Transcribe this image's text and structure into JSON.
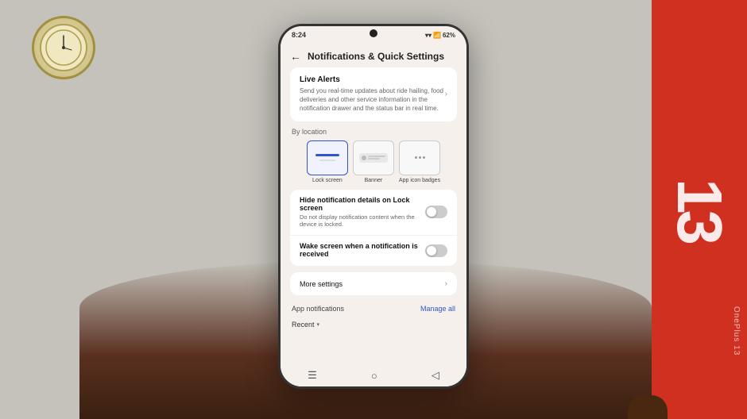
{
  "scene": {
    "bg_color": "#c5c2bb"
  },
  "status_bar": {
    "time": "8:24",
    "battery": "62%",
    "wifi": "WiFi"
  },
  "header": {
    "back_label": "←",
    "title": "Notifications & Quick Settings"
  },
  "live_alerts": {
    "title": "Live Alerts",
    "description": "Send you real-time updates about ride hailing, food deliveries and other service information in the notification drawer and the status bar in real time."
  },
  "by_location": {
    "label": "By location",
    "types": [
      {
        "id": "lock_screen",
        "label": "Lock screen",
        "active": true,
        "type": "bar"
      },
      {
        "id": "banner",
        "label": "Banner",
        "active": false,
        "type": "banner"
      },
      {
        "id": "app_icon_badges",
        "label": "App icon badges",
        "active": false,
        "type": "dots"
      }
    ]
  },
  "toggles": [
    {
      "id": "hide_notification",
      "title": "Hide notification details on Lock screen",
      "desc": "Do not display notification content when the device is locked.",
      "on": false
    },
    {
      "id": "wake_screen",
      "title": "Wake screen when a notification is received",
      "desc": "",
      "on": false
    }
  ],
  "more_settings": {
    "label": "More settings"
  },
  "app_notifications": {
    "label": "App notifications",
    "manage_all": "Manage all"
  },
  "recent": {
    "label": "Recent"
  },
  "nav_bar": {
    "menu_icon": "☰",
    "home_icon": "○",
    "back_icon": "◁"
  }
}
